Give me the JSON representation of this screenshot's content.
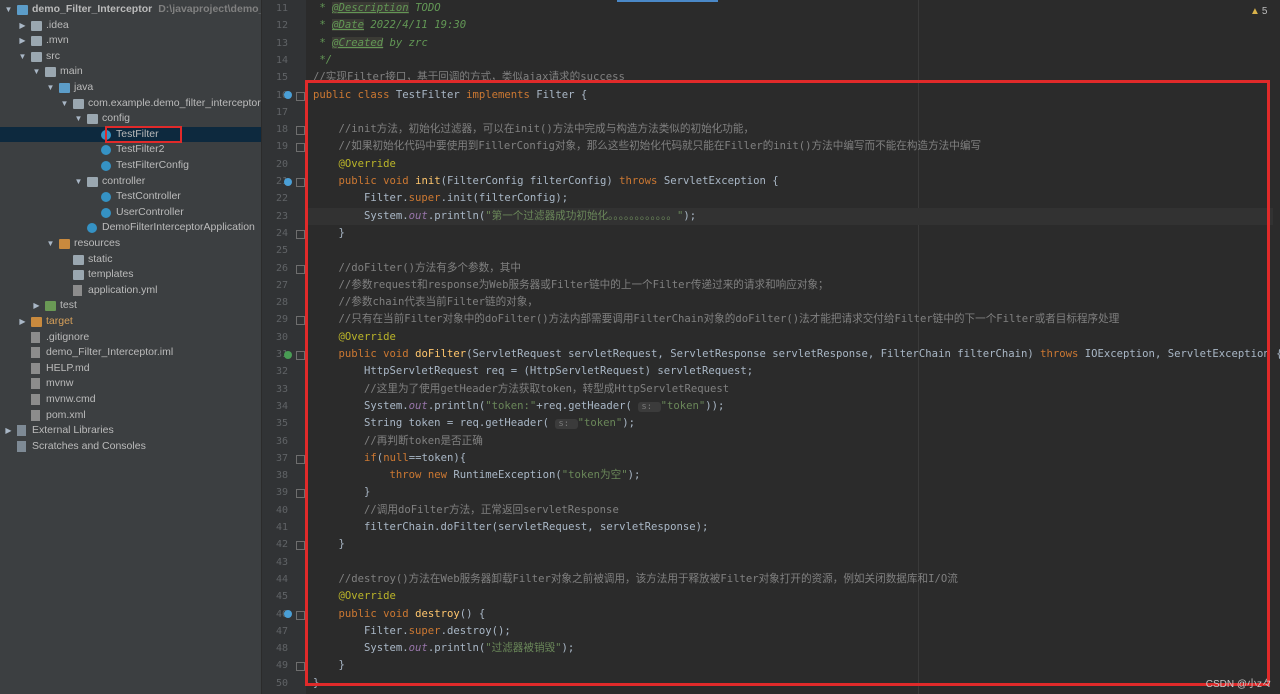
{
  "project_tree": [
    {
      "depth": 0,
      "arrow": "▼",
      "icon": "folder blue",
      "icon_name": "module-folder-icon",
      "label": "demo_Filter_Interceptor",
      "path": "D:\\javaproject\\demo_Filt",
      "bold": true
    },
    {
      "depth": 1,
      "arrow": "▶",
      "icon": "folder",
      "icon_name": "folder-icon",
      "label": ".idea"
    },
    {
      "depth": 1,
      "arrow": "▶",
      "icon": "folder",
      "icon_name": "folder-icon",
      "label": ".mvn"
    },
    {
      "depth": 1,
      "arrow": "▼",
      "icon": "folder",
      "icon_name": "folder-icon",
      "label": "src"
    },
    {
      "depth": 2,
      "arrow": "▼",
      "icon": "folder",
      "icon_name": "folder-icon",
      "label": "main"
    },
    {
      "depth": 3,
      "arrow": "▼",
      "icon": "folder blue",
      "icon_name": "source-folder-icon",
      "label": "java"
    },
    {
      "depth": 4,
      "arrow": "▼",
      "icon": "folder",
      "icon_name": "package-icon",
      "label": "com.example.demo_filter_interceptor"
    },
    {
      "depth": 5,
      "arrow": "▼",
      "icon": "folder",
      "icon_name": "package-icon",
      "label": "config"
    },
    {
      "depth": 6,
      "arrow": "",
      "icon": "cls",
      "icon_name": "class-icon",
      "label": "TestFilter",
      "selected": true
    },
    {
      "depth": 6,
      "arrow": "",
      "icon": "cls",
      "icon_name": "class-icon",
      "label": "TestFilter2"
    },
    {
      "depth": 6,
      "arrow": "",
      "icon": "cls",
      "icon_name": "class-icon",
      "label": "TestFilterConfig"
    },
    {
      "depth": 5,
      "arrow": "▼",
      "icon": "folder",
      "icon_name": "package-icon",
      "label": "controller"
    },
    {
      "depth": 6,
      "arrow": "",
      "icon": "cls",
      "icon_name": "class-icon",
      "label": "TestController"
    },
    {
      "depth": 6,
      "arrow": "",
      "icon": "cls",
      "icon_name": "class-icon",
      "label": "UserController"
    },
    {
      "depth": 5,
      "arrow": "",
      "icon": "cls",
      "icon_name": "spring-boot-class-icon",
      "label": "DemoFilterInterceptorApplication"
    },
    {
      "depth": 3,
      "arrow": "▼",
      "icon": "folder orange",
      "icon_name": "resources-folder-icon",
      "label": "resources"
    },
    {
      "depth": 4,
      "arrow": "",
      "icon": "folder",
      "icon_name": "folder-icon",
      "label": "static"
    },
    {
      "depth": 4,
      "arrow": "",
      "icon": "folder",
      "icon_name": "folder-icon",
      "label": "templates"
    },
    {
      "depth": 4,
      "arrow": "",
      "icon": "file",
      "icon_name": "yaml-file-icon",
      "label": "application.yml"
    },
    {
      "depth": 2,
      "arrow": "▶",
      "icon": "folder green",
      "icon_name": "test-folder-icon",
      "label": "test"
    },
    {
      "depth": 1,
      "arrow": "▶",
      "icon": "folder orange",
      "icon_name": "excluded-folder-icon",
      "label": "target",
      "target": true
    },
    {
      "depth": 1,
      "arrow": "",
      "icon": "file",
      "icon_name": "gitignore-file-icon",
      "label": ".gitignore"
    },
    {
      "depth": 1,
      "arrow": "",
      "icon": "file",
      "icon_name": "iml-file-icon",
      "label": "demo_Filter_Interceptor.iml"
    },
    {
      "depth": 1,
      "arrow": "",
      "icon": "file",
      "icon_name": "markdown-file-icon",
      "label": "HELP.md"
    },
    {
      "depth": 1,
      "arrow": "",
      "icon": "file",
      "icon_name": "file-icon",
      "label": "mvnw"
    },
    {
      "depth": 1,
      "arrow": "",
      "icon": "file",
      "icon_name": "cmd-file-icon",
      "label": "mvnw.cmd"
    },
    {
      "depth": 1,
      "arrow": "",
      "icon": "file",
      "icon_name": "maven-file-icon",
      "label": "pom.xml"
    },
    {
      "depth": 0,
      "arrow": "▶",
      "icon": "lib",
      "icon_name": "libraries-icon",
      "label": "External Libraries"
    },
    {
      "depth": 0,
      "arrow": "",
      "icon": "lib",
      "icon_name": "scratches-icon",
      "label": "Scratches and Consoles"
    }
  ],
  "editor": {
    "warnings": "5",
    "lines": [
      {
        "n": "11",
        "tokens": [
          [
            " * ",
            "jd"
          ],
          [
            "@Description",
            "jdtag"
          ],
          [
            " TODO",
            "jd"
          ]
        ]
      },
      {
        "n": "12",
        "tokens": [
          [
            " * ",
            "jd"
          ],
          [
            "@Date",
            "jdtag"
          ],
          [
            " 2022/4/11 19:30",
            "jd"
          ]
        ]
      },
      {
        "n": "13",
        "tokens": [
          [
            " * ",
            "jd"
          ],
          [
            "@Created",
            "jdtag"
          ],
          [
            " by zrc",
            "jd"
          ]
        ]
      },
      {
        "n": "14",
        "tokens": [
          [
            " */",
            "jd"
          ]
        ]
      },
      {
        "n": "15",
        "tokens": [
          [
            "//实现Filter接口，基于回调的方式，类似ajax请求的success",
            "cm"
          ]
        ]
      },
      {
        "n": "16",
        "mark": "impl",
        "fold": true,
        "tokens": [
          [
            "public class ",
            "kw"
          ],
          [
            "TestFilter ",
            ""
          ],
          [
            "implements ",
            "kw"
          ],
          [
            "Filter {",
            ""
          ]
        ]
      },
      {
        "n": "17",
        "tokens": []
      },
      {
        "n": "18",
        "fold": true,
        "tokens": [
          [
            "    //init方法，初始化过滤器，可以在init()方法中完成与构造方法类似的初始化功能，",
            "cm"
          ]
        ]
      },
      {
        "n": "19",
        "fold": true,
        "tokens": [
          [
            "    //如果初始化代码中要使用到FillerConfig对象，那么这些初始化代码就只能在Filler的init()方法中编写而不能在构造方法中编写",
            "cm"
          ]
        ]
      },
      {
        "n": "20",
        "tokens": [
          [
            "    @Override",
            "ann"
          ]
        ]
      },
      {
        "n": "21",
        "mark": "impl",
        "fold": true,
        "tokens": [
          [
            "    public void ",
            "kw"
          ],
          [
            "init",
            "fn"
          ],
          [
            "(FilterConfig filterConfig) ",
            ""
          ],
          [
            "throws ",
            "kw"
          ],
          [
            "ServletException {",
            ""
          ]
        ]
      },
      {
        "n": "22",
        "tokens": [
          [
            "        Filter.",
            ""
          ],
          [
            "super",
            "kw"
          ],
          [
            ".init(filterConfig);",
            ""
          ]
        ]
      },
      {
        "n": "23",
        "caret": true,
        "tokens": [
          [
            "        System.",
            ""
          ],
          [
            "out",
            "fld"
          ],
          [
            ".println(",
            ""
          ],
          [
            "\"第一个过滤器成功初始化。。。。。。。。。。。。\"",
            "str"
          ],
          [
            ");",
            ""
          ]
        ]
      },
      {
        "n": "24",
        "fold": true,
        "tokens": [
          [
            "    }",
            ""
          ]
        ]
      },
      {
        "n": "25",
        "tokens": []
      },
      {
        "n": "26",
        "fold": true,
        "tokens": [
          [
            "    //doFilter()方法有多个参数，其中",
            "cm"
          ]
        ]
      },
      {
        "n": "27",
        "tokens": [
          [
            "    //参数request和response为Web服务器或Filter链中的上一个Filter传递过来的请求和响应对象；",
            "cm"
          ]
        ]
      },
      {
        "n": "28",
        "tokens": [
          [
            "    //参数chain代表当前Filter链的对象，",
            "cm"
          ]
        ]
      },
      {
        "n": "29",
        "fold": true,
        "tokens": [
          [
            "    //只有在当前Filter对象中的doFilter()方法内部需要调用FilterChain对象的doFilter()法才能把请求交付给Filter链中的下一个Filter或者目标程序处理",
            "cm"
          ]
        ]
      },
      {
        "n": "30",
        "tokens": [
          [
            "    @Override",
            "ann"
          ]
        ]
      },
      {
        "n": "31",
        "mark": "over",
        "fold": true,
        "tokens": [
          [
            "    public void ",
            "kw"
          ],
          [
            "doFilter",
            "fn"
          ],
          [
            "(ServletRequest servletRequest, ServletResponse servletResponse, FilterChain filterChain) ",
            ""
          ],
          [
            "throws ",
            "kw"
          ],
          [
            "IOException, ServletException {",
            ""
          ]
        ]
      },
      {
        "n": "32",
        "tokens": [
          [
            "        HttpServletRequest req = (HttpServletRequest) servletRequest;",
            ""
          ]
        ]
      },
      {
        "n": "33",
        "tokens": [
          [
            "        //这里为了使用getHeader方法获取token，转型成HttpServletRequest",
            "cm"
          ]
        ]
      },
      {
        "n": "34",
        "tokens": [
          [
            "        System.",
            ""
          ],
          [
            "out",
            "fld"
          ],
          [
            ".println(",
            ""
          ],
          [
            "\"token:\"",
            "str"
          ],
          [
            "+req.getHeader( ",
            ""
          ],
          [
            "s: ",
            "hint"
          ],
          [
            "\"token\"",
            "str"
          ],
          [
            "));",
            ""
          ]
        ]
      },
      {
        "n": "35",
        "tokens": [
          [
            "        String token = req.getHeader( ",
            ""
          ],
          [
            "s: ",
            "hint"
          ],
          [
            "\"token\"",
            "str"
          ],
          [
            ");",
            ""
          ]
        ]
      },
      {
        "n": "36",
        "tokens": [
          [
            "        //再判断token是否正确",
            "cm"
          ]
        ]
      },
      {
        "n": "37",
        "fold": true,
        "tokens": [
          [
            "        ",
            ""
          ],
          [
            "if",
            "kw"
          ],
          [
            "(",
            ""
          ],
          [
            "null",
            "kw"
          ],
          [
            "==token){",
            ""
          ]
        ]
      },
      {
        "n": "38",
        "tokens": [
          [
            "            ",
            ""
          ],
          [
            "throw new ",
            "kw"
          ],
          [
            "RuntimeException(",
            ""
          ],
          [
            "\"token为空\"",
            "str"
          ],
          [
            ");",
            ""
          ]
        ]
      },
      {
        "n": "39",
        "fold": true,
        "tokens": [
          [
            "        }",
            ""
          ]
        ]
      },
      {
        "n": "40",
        "tokens": [
          [
            "        //调用doFilter方法，正常返回servletResponse",
            "cm"
          ]
        ]
      },
      {
        "n": "41",
        "tokens": [
          [
            "        filterChain.doFilter(servletRequest, servletResponse);",
            ""
          ]
        ]
      },
      {
        "n": "42",
        "fold": true,
        "tokens": [
          [
            "    }",
            ""
          ]
        ]
      },
      {
        "n": "43",
        "tokens": []
      },
      {
        "n": "44",
        "tokens": [
          [
            "    //destroy()方法在Web服务器卸载Filter对象之前被调用，该方法用于释放被Filter对象打开的资源，例如关闭数据库和I/O流",
            "cm"
          ]
        ]
      },
      {
        "n": "45",
        "tokens": [
          [
            "    @Override",
            "ann"
          ]
        ]
      },
      {
        "n": "46",
        "mark": "impl",
        "fold": true,
        "tokens": [
          [
            "    public void ",
            "kw"
          ],
          [
            "destroy",
            "fn"
          ],
          [
            "() {",
            ""
          ]
        ]
      },
      {
        "n": "47",
        "tokens": [
          [
            "        Filter.",
            ""
          ],
          [
            "super",
            "kw"
          ],
          [
            ".destroy();",
            ""
          ]
        ]
      },
      {
        "n": "48",
        "tokens": [
          [
            "        System.",
            ""
          ],
          [
            "out",
            "fld"
          ],
          [
            ".println(",
            ""
          ],
          [
            "\"过滤器被销毁\"",
            "str"
          ],
          [
            ");",
            ""
          ]
        ]
      },
      {
        "n": "49",
        "fold": true,
        "tokens": [
          [
            "    }",
            ""
          ]
        ]
      },
      {
        "n": "50",
        "tokens": [
          [
            "}",
            ""
          ]
        ]
      }
    ]
  },
  "watermark": "CSDN @小z々"
}
